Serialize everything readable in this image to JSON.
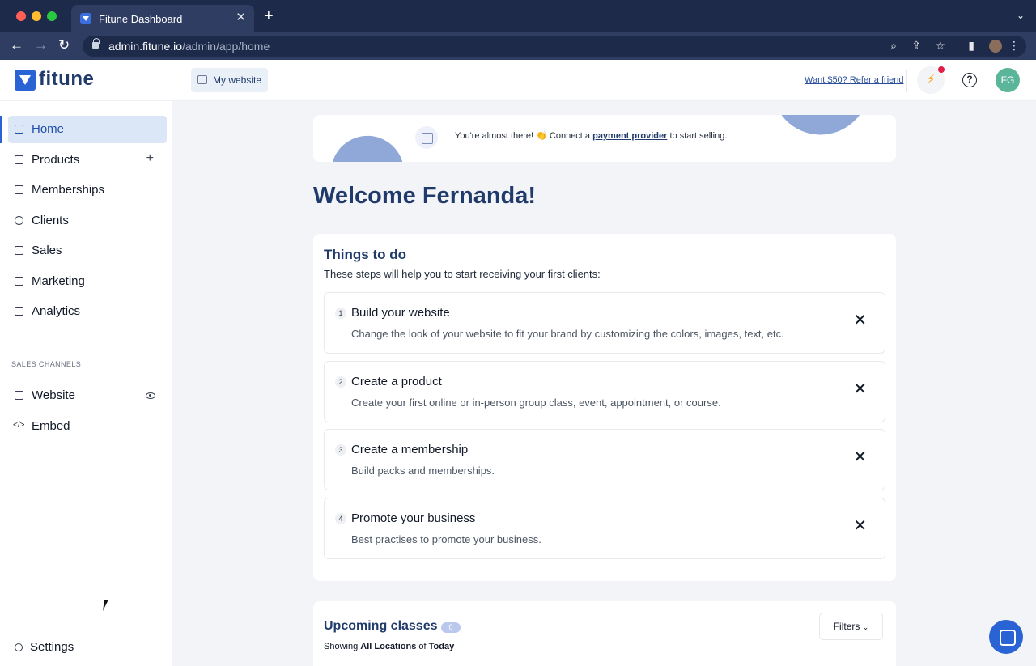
{
  "browser": {
    "tab_title": "Fitune Dashboard",
    "url_domain": "admin.fitune.io",
    "url_path": "/admin/app/home"
  },
  "header": {
    "logo_text": "fitune",
    "my_website_label": "My website",
    "refer_link": "Want $50? Refer a friend",
    "avatar_initials": "FG"
  },
  "sidebar": {
    "items": [
      {
        "label": "Home"
      },
      {
        "label": "Products"
      },
      {
        "label": "Memberships"
      },
      {
        "label": "Clients"
      },
      {
        "label": "Sales"
      },
      {
        "label": "Marketing"
      },
      {
        "label": "Analytics"
      }
    ],
    "section_title": "SALES CHANNELS",
    "channels": [
      {
        "label": "Website"
      },
      {
        "label": "Embed"
      }
    ],
    "settings_label": "Settings"
  },
  "banner": {
    "text_before": "You're almost there! 👏 Connect a ",
    "link": "payment provider",
    "text_after": " to start selling."
  },
  "welcome": "Welcome Fernanda!",
  "todo": {
    "title": "Things to do",
    "subtitle": "These steps will help you to start receiving your first clients:",
    "steps": [
      {
        "num": "1",
        "title": "Build your website",
        "desc": "Change the look of your website to fit your brand by customizing the colors, images, text, etc."
      },
      {
        "num": "2",
        "title": "Create a product",
        "desc": "Create your first online or in-person group class, event, appointment, or course."
      },
      {
        "num": "3",
        "title": "Create a membership",
        "desc": "Build packs and memberships."
      },
      {
        "num": "4",
        "title": "Promote your business",
        "desc": "Best practises to promote your business."
      }
    ]
  },
  "upcoming": {
    "title": "Upcoming classes",
    "count": "0",
    "showing": "Showing",
    "locations": "All Locations",
    "of": "of",
    "period": "Today",
    "filters_label": "Filters"
  },
  "colors": {
    "brand": "#2a63d4",
    "heading": "#1f3a6b",
    "active_nav": "#dbe7f7"
  }
}
